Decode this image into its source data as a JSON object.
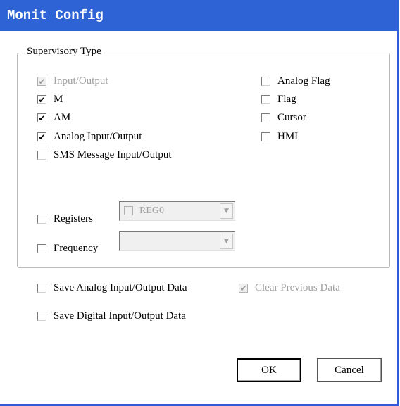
{
  "window": {
    "title": "Monit Config"
  },
  "group": {
    "label": "Supervisory Type",
    "left_items": [
      {
        "label": "Input/Output",
        "checked": true,
        "disabled": true
      },
      {
        "label": "M",
        "checked": true,
        "disabled": false
      },
      {
        "label": "AM",
        "checked": true,
        "disabled": false
      },
      {
        "label": "Analog Input/Output",
        "checked": true,
        "disabled": false
      },
      {
        "label": "SMS Message Input/Output",
        "checked": false,
        "disabled": false
      }
    ],
    "right_items": [
      {
        "label": "Analog Flag",
        "checked": false
      },
      {
        "label": "Flag",
        "checked": false
      },
      {
        "label": "Cursor",
        "checked": false
      },
      {
        "label": "HMI",
        "checked": false
      }
    ],
    "registers": {
      "label": "Registers",
      "checked": false,
      "combo_value": "REG0"
    },
    "frequency": {
      "label": "Frequency",
      "checked": false,
      "combo_value": ""
    }
  },
  "options": {
    "save_analog": {
      "label": "Save Analog Input/Output Data",
      "checked": false
    },
    "clear_previous": {
      "label": "Clear Previous Data",
      "checked": true,
      "disabled": true
    },
    "save_digital": {
      "label": "Save Digital Input/Output Data",
      "checked": false
    }
  },
  "buttons": {
    "ok": "OK",
    "cancel": "Cancel"
  }
}
